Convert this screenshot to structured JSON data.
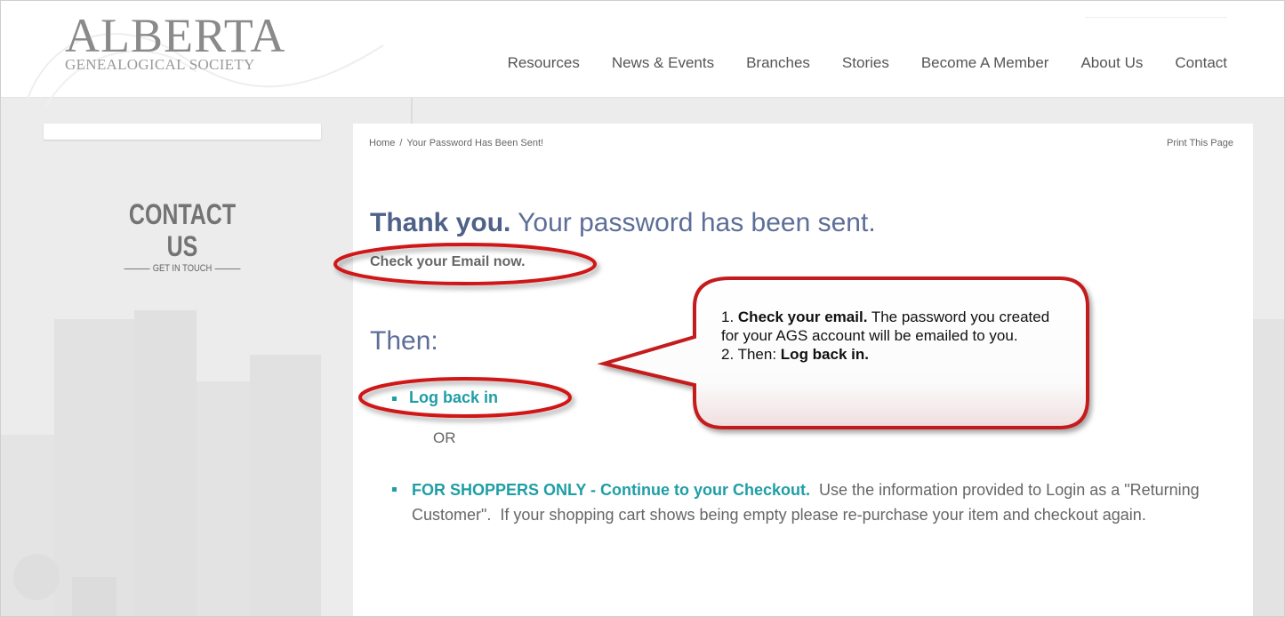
{
  "brand": {
    "name": "ALBERTA",
    "tagline": "GENEALOGICAL SOCIETY"
  },
  "nav": {
    "items": [
      "Resources",
      "News & Events",
      "Branches",
      "Stories",
      "Become A Member",
      "About Us",
      "Contact"
    ]
  },
  "sidebar": {
    "contact_title": "CONTACT US",
    "contact_subtitle": "GET IN TOUCH"
  },
  "content": {
    "breadcrumb": {
      "home": "Home",
      "separator": "/",
      "current": "Your Password Has Been Sent!"
    },
    "print_label": "Print This Page",
    "headline_bold": "Thank you.",
    "headline_rest": " Your password has been sent.",
    "check_email": "Check your Email now.",
    "then": "Then:",
    "login_link": "Log back in",
    "or": "OR",
    "shoppers_link": "FOR SHOPPERS ONLY - Continue to your Checkout.",
    "shoppers_text": "  Use the information provided to Login as a \"Returning Customer\".  If your shopping cart shows being empty please re-purchase your item and checkout again."
  },
  "callout": {
    "line1_prefix": "1. ",
    "line1_bold": "Check your email.",
    "line1_rest": " The password you created for your AGS account will be emailed to you.",
    "line2_prefix": "2. Then: ",
    "line2_bold": "Log back in."
  },
  "colors": {
    "accent_teal": "#1f9ea6",
    "heading_blue": "#5d6e98",
    "annotation_red": "#d01818"
  }
}
